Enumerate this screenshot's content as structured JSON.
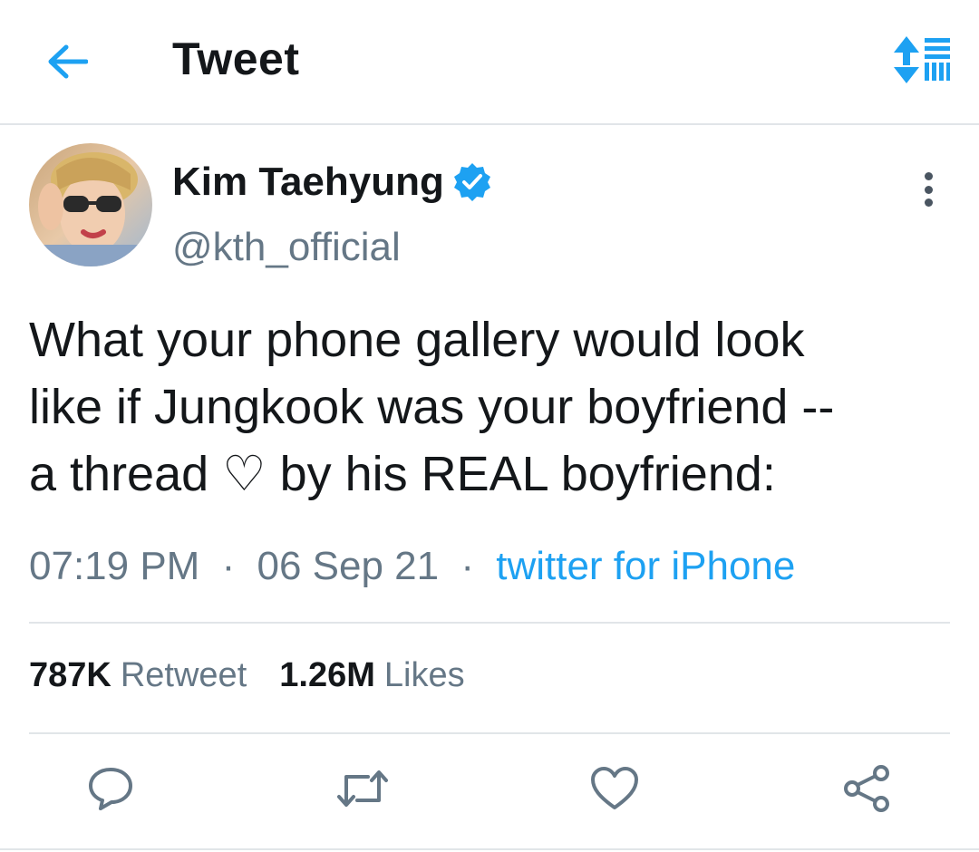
{
  "header": {
    "title": "Tweet",
    "back_icon": "arrow-left-icon",
    "sort_icon": "sort-list-icon",
    "accent_color": "#1da1f2"
  },
  "tweet": {
    "author": {
      "display_name": "Kim Taehyung",
      "handle": "@kth_official",
      "verified": true,
      "avatar_icon": "avatar-photo"
    },
    "text_lines": [
      "What your phone gallery would look",
      "like if Jungkook was your boyfriend --",
      "a thread ♡ by his REAL boyfriend:"
    ],
    "time": "07:19 PM",
    "date": "06 Sep 21",
    "separator": "·",
    "source": "twitter for iPhone",
    "stats": {
      "retweets_count": "787K",
      "retweets_label": "Retweet",
      "likes_count": "1.26M",
      "likes_label": "Likes"
    },
    "actions": [
      "reply-icon",
      "retweet-icon",
      "like-icon",
      "share-icon"
    ]
  }
}
